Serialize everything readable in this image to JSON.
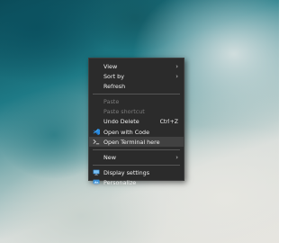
{
  "context_menu": {
    "items": [
      {
        "label": "View",
        "submenu": true
      },
      {
        "label": "Sort by",
        "submenu": true
      },
      {
        "label": "Refresh"
      },
      {
        "label": "Paste",
        "disabled": true
      },
      {
        "label": "Paste shortcut",
        "disabled": true
      },
      {
        "label": "Undo Delete",
        "shortcut": "Ctrl+Z"
      },
      {
        "label": "Open with Code",
        "icon": "vscode-icon"
      },
      {
        "label": "Open Terminal here",
        "icon": "terminal-icon",
        "highlighted": true
      },
      {
        "label": "New",
        "submenu": true
      },
      {
        "label": "Display settings",
        "icon": "display-settings-icon"
      },
      {
        "label": "Personalize",
        "icon": "personalize-icon"
      }
    ],
    "submenu_glyph": "›"
  },
  "colors": {
    "menu_bg": "#2b2b2b",
    "hover_bg": "#414141",
    "vscode_blue": "#2a8be0"
  }
}
